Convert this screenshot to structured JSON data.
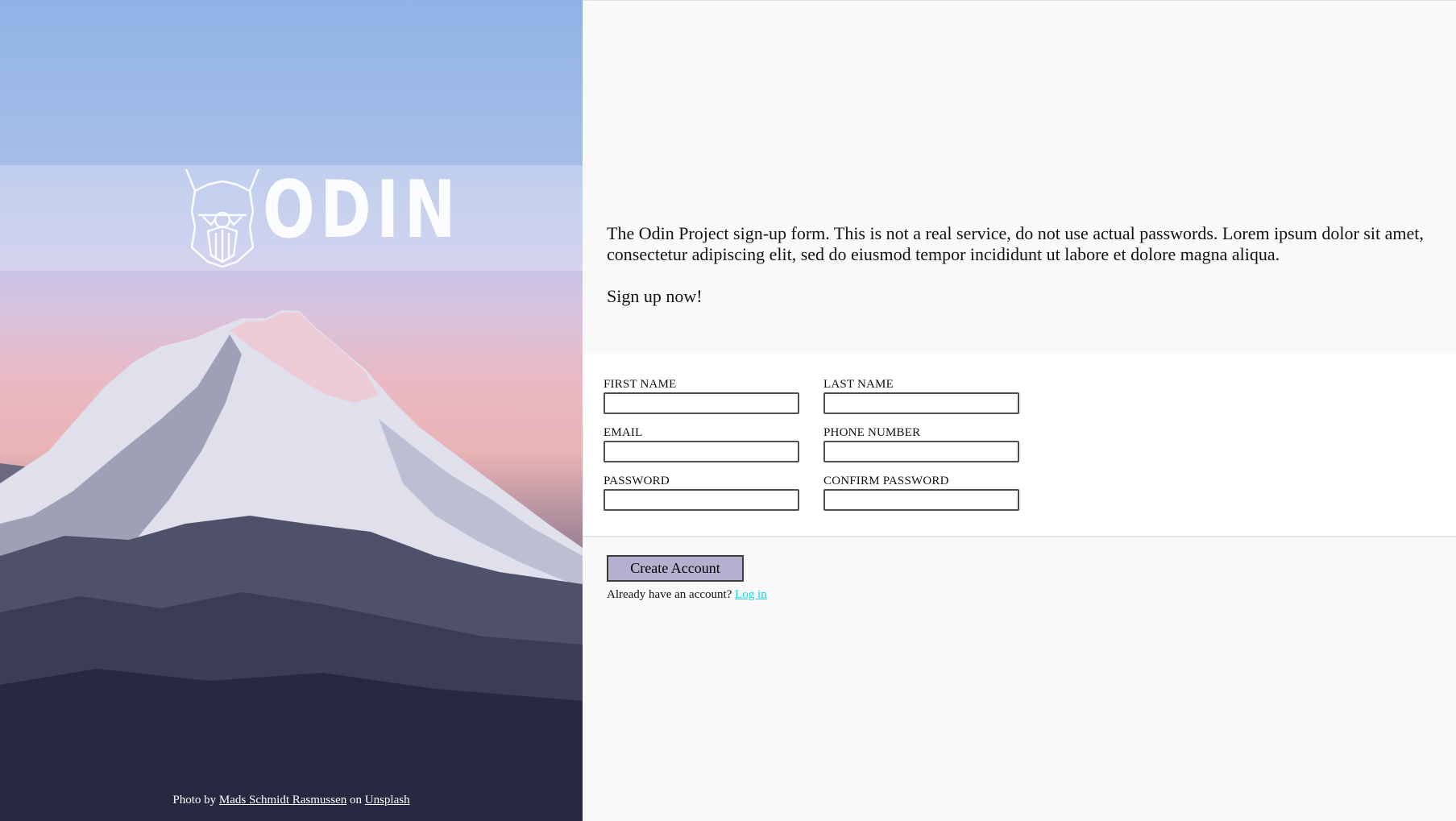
{
  "hero": {
    "logo_text": "ODIN",
    "credit": {
      "prefix": "Photo by",
      "author": "Mads Schmidt Rasmussen",
      "on": "on",
      "site": "Unsplash"
    }
  },
  "intro": {
    "text": "The Odin Project sign-up form. This is not a real service, do not use actual passwords. Lorem ipsum dolor sit amet, consectetur adipiscing elit, sed do eiusmod tempor incididunt ut labore et dolore magna aliqua.",
    "cta": "Sign up now!"
  },
  "form": {
    "fields": {
      "first_name": {
        "label": "FIRST NAME",
        "value": ""
      },
      "last_name": {
        "label": "LAST NAME",
        "value": ""
      },
      "email": {
        "label": "EMAIL",
        "value": ""
      },
      "phone": {
        "label": "PHONE NUMBER",
        "value": ""
      },
      "password": {
        "label": "PASSWORD",
        "value": ""
      },
      "confirm_password": {
        "label": "CONFIRM PASSWORD",
        "value": ""
      }
    },
    "submit_label": "Create Account",
    "login_prompt": "Already have an account?",
    "login_link": "Log in"
  },
  "colors": {
    "button_bg": "#b3b1cf",
    "link": "#15d5e8"
  }
}
